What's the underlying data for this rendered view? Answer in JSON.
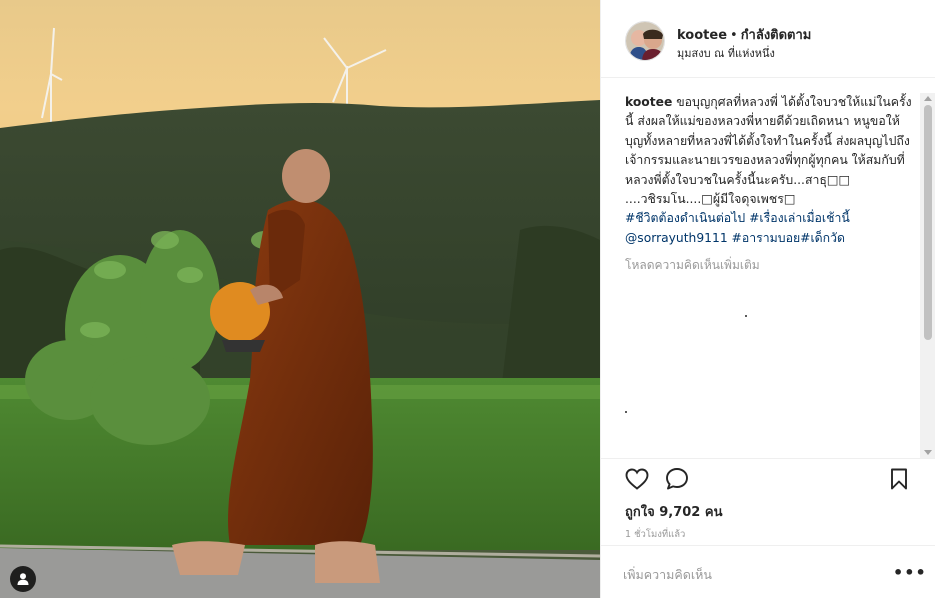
{
  "post": {
    "username": "kootee",
    "separator": "•",
    "follow_label": "กำลังติดตาม",
    "location": "มุมสงบ ณ ที่แห่งหนึ่ง"
  },
  "caption": {
    "username": "kootee",
    "text": " ขอบุญกุศลที่หลวงพี่ ได้ตั้งใจบวชให้แม่ในครั้งนี้ ส่งผลให้แม่ของหลวงพี่หายดีด้วยเถิดหนา หนูขอให้บุญทั้งหลายที่หลวงพี่ได้ตั้งใจทำในครั้งนี้ ส่งผลบุญไปถึงเจ้ากรรมและนายเวรของหลวงพี่ทุกผู้ทุกคน ให้สมกับที่หลวงพี่ตั้งใจบวชในครั้งนี้นะครับ...สาธุ□□\n....วชิรมโน....□ผู้มีใจดุจเพชร□\n",
    "hashtags_line1": "#ชีวิตต้องดำเนินต่อไป #เรื่องเล่าเมื่อเช้านี้",
    "mention": "@sorrayuth9111",
    "hashtags_line2": " #อารามบอย#เด็กวัด"
  },
  "comments": {
    "load_more_label": "โหลดความคิดเห็นเพิ่มเติม"
  },
  "stats": {
    "likes_label": "ถูกใจ 9,702 คน",
    "timestamp": "1 ชั่วโมงที่แล้ว"
  },
  "composer": {
    "placeholder": "เพิ่มความคิดเห็น",
    "more_label": "•••"
  },
  "icons": {
    "like": "heart-outline-icon",
    "comment": "speech-bubble-icon",
    "save": "bookmark-icon",
    "tag": "person-tag-icon"
  },
  "colors": {
    "link": "#003569",
    "muted": "#999999",
    "text": "#262626",
    "border": "#efefef"
  }
}
